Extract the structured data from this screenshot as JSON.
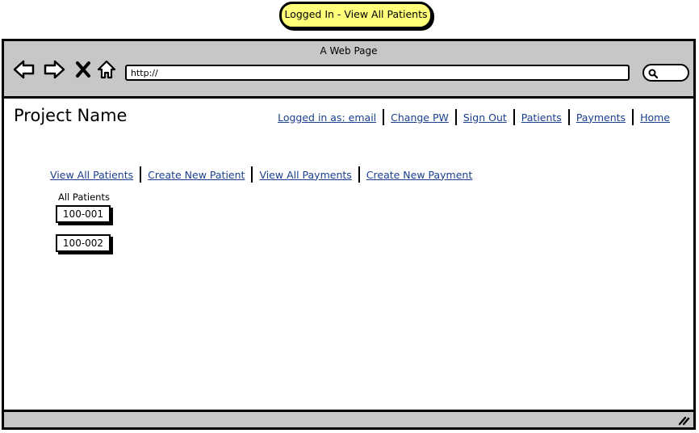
{
  "sticky_label": "Logged In - View All Patients",
  "window": {
    "title": "A Web Page",
    "url": "http://"
  },
  "toolbar_icons": [
    "back-arrow-icon",
    "forward-arrow-icon",
    "close-x-icon",
    "home-icon",
    "search-icon"
  ],
  "header": {
    "project_name": "Project Name",
    "nav": [
      {
        "label": "Logged in as: email"
      },
      {
        "label": "Change PW"
      },
      {
        "label": "Sign Out"
      },
      {
        "label": "Patients"
      },
      {
        "label": "Payments"
      },
      {
        "label": "Home"
      }
    ]
  },
  "sub_nav": [
    {
      "label": "View All Patients"
    },
    {
      "label": "Create New Patient"
    },
    {
      "label": "View All Payments"
    },
    {
      "label": "Create New Payment"
    }
  ],
  "patients": {
    "label": "All Patients",
    "items": [
      "100-001",
      "100-002"
    ]
  },
  "colors": {
    "sticky": "#ffff7a",
    "chrome": "#c7c7c7",
    "link": "#1a3f8f"
  }
}
